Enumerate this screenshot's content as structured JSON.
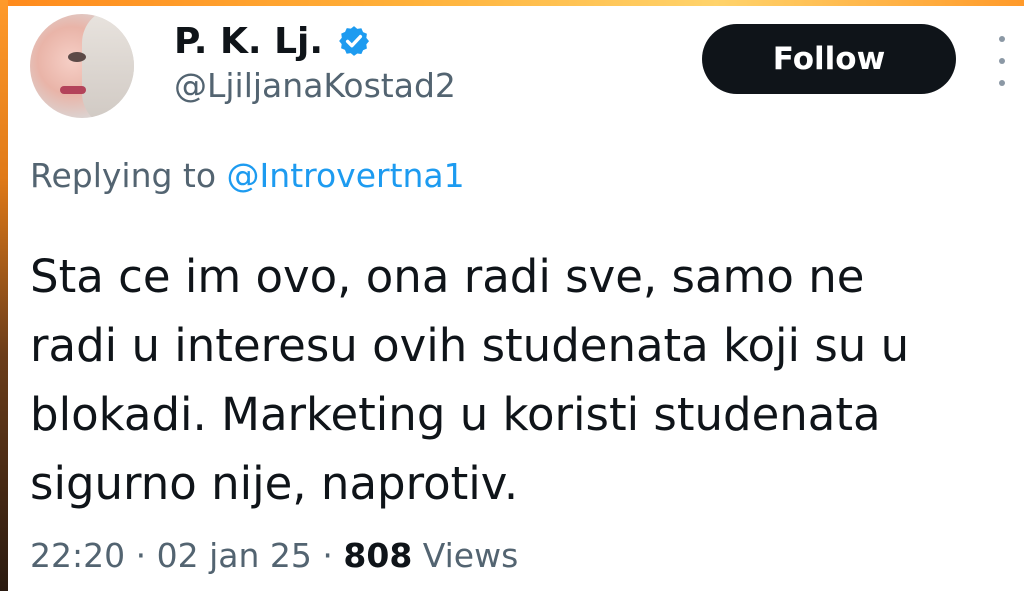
{
  "user": {
    "display_name": "P. K. Lj.",
    "handle": "@LjiljanaKostad2",
    "verified": true,
    "verified_color": "#1d9bf0"
  },
  "actions": {
    "follow_label": "Follow",
    "more_icon": "more-vertical-icon"
  },
  "reply": {
    "prefix": "Replying to",
    "to_handle": "@Introvertna1"
  },
  "tweet": {
    "text": "Sta ce im ovo, ona radi sve, samo ne\nradi u interesu ovih studenata koji su u\nblokadi. Marketing u koristi studenata\nsigurno nije, naprotiv."
  },
  "meta": {
    "time": "22:20",
    "date": "02 jan 25",
    "separator": "·",
    "views_count": "808",
    "views_label": "Views"
  },
  "colors": {
    "accent": "#1d9bf0",
    "text_primary": "#0f1419",
    "text_secondary": "#536471",
    "button_bg": "#0f1419"
  }
}
